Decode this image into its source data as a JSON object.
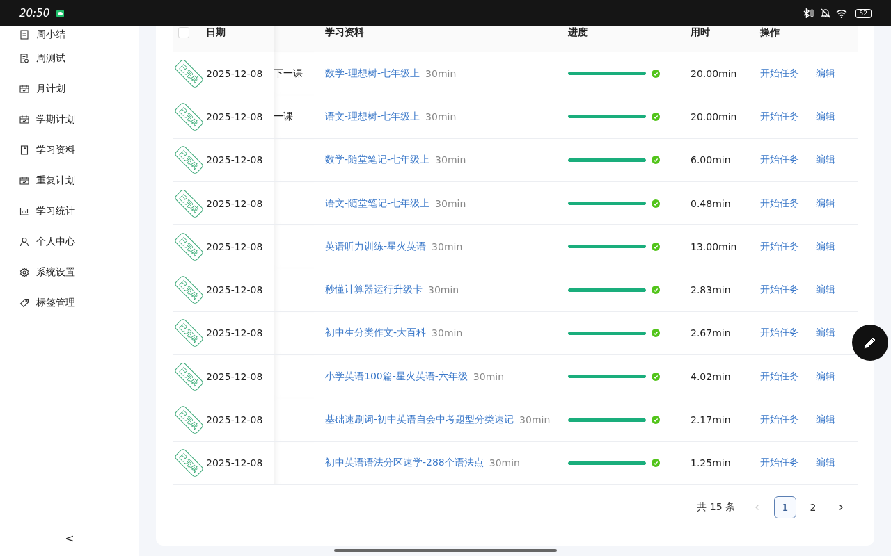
{
  "status_bar": {
    "time": "20:50",
    "battery": "52"
  },
  "sidebar": {
    "items": [
      {
        "label": "周小结"
      },
      {
        "label": "周测试"
      },
      {
        "label": "月计划"
      },
      {
        "label": "学期计划"
      },
      {
        "label": "学习资料"
      },
      {
        "label": "重复计划"
      },
      {
        "label": "学习统计"
      },
      {
        "label": "个人中心"
      },
      {
        "label": "系统设置"
      },
      {
        "label": "标签管理"
      }
    ],
    "collapse": "<"
  },
  "table": {
    "header_checked": false,
    "columns": [
      "日期",
      "学习资料",
      "进度",
      "用时",
      "操作"
    ],
    "rows": [
      {
        "stamp": "已完成",
        "date": "2025-12-08",
        "column_2": "下一课",
        "material": "数学-理想树-七年级上",
        "duration": "30min",
        "level": 1,
        "time_used": "20.00min",
        "actions": [
          "开始任务",
          "编辑"
        ]
      },
      {
        "stamp": "已完成",
        "date": "2025-12-08",
        "column_2": "一课",
        "material": "语文-理想树-七年级上",
        "duration": "30min",
        "level": 1,
        "time_used": "20.00min",
        "actions": [
          "开始任务",
          "编辑"
        ]
      },
      {
        "stamp": "已完成",
        "date": "2025-12-08",
        "material": "数学-随堂笔记-七年级上",
        "duration": "30min",
        "level": 1,
        "time_used": "6.00min",
        "actions": [
          "开始任务",
          "编辑"
        ]
      },
      {
        "stamp": "已完成",
        "date": "2025-12-08",
        "material": "语文-随堂笔记-七年级上",
        "duration": "30min",
        "level": 1,
        "time_used": "0.48min",
        "actions": [
          "开始任务",
          "编辑"
        ]
      },
      {
        "stamp": "已完成",
        "date": "2025-12-08",
        "material": "英语听力训练-星火英语",
        "duration": "30min",
        "level": 1,
        "time_used": "13.00min",
        "actions": [
          "开始任务",
          "编辑"
        ]
      },
      {
        "stamp": "已完成",
        "date": "2025-12-08",
        "material": "秒懂计算器运行升级卡",
        "duration": "30min",
        "level": 1,
        "time_used": "2.83min",
        "actions": [
          "开始任务",
          "编辑"
        ]
      },
      {
        "stamp": "已完成",
        "date": "2025-12-08",
        "material": "初中生分类作文-大百科",
        "duration": "30min",
        "level": 1,
        "time_used": "2.67min",
        "actions": [
          "开始任务",
          "编辑"
        ]
      },
      {
        "stamp": "已完成",
        "date": "2025-12-08",
        "material": "小学英语100篇-星火英语-六年级",
        "duration": "30min",
        "level": 1,
        "time_used": "4.02min",
        "actions": [
          "开始任务",
          "编辑"
        ]
      },
      {
        "stamp": "已完成",
        "date": "2025-12-08",
        "material": "基础速刷词-初中英语自会中考题型分类速记",
        "duration": "30min",
        "level": 1,
        "time_used": "2.17min",
        "actions": [
          "开始任务",
          "编辑"
        ]
      },
      {
        "stamp": "已完成",
        "date": "2025-12-08",
        "material": "初中英语语法分区速学-288个语法点",
        "duration": "30min",
        "level": 1,
        "time_used": "1.25min",
        "actions": [
          "开始任务",
          "编辑"
        ]
      }
    ]
  },
  "pagination": {
    "total": "共 15 条",
    "prev_disabled": true,
    "pages": [
      {
        "label": "1",
        "selected": true
      },
      {
        "label": "2",
        "selected": false
      }
    ]
  }
}
